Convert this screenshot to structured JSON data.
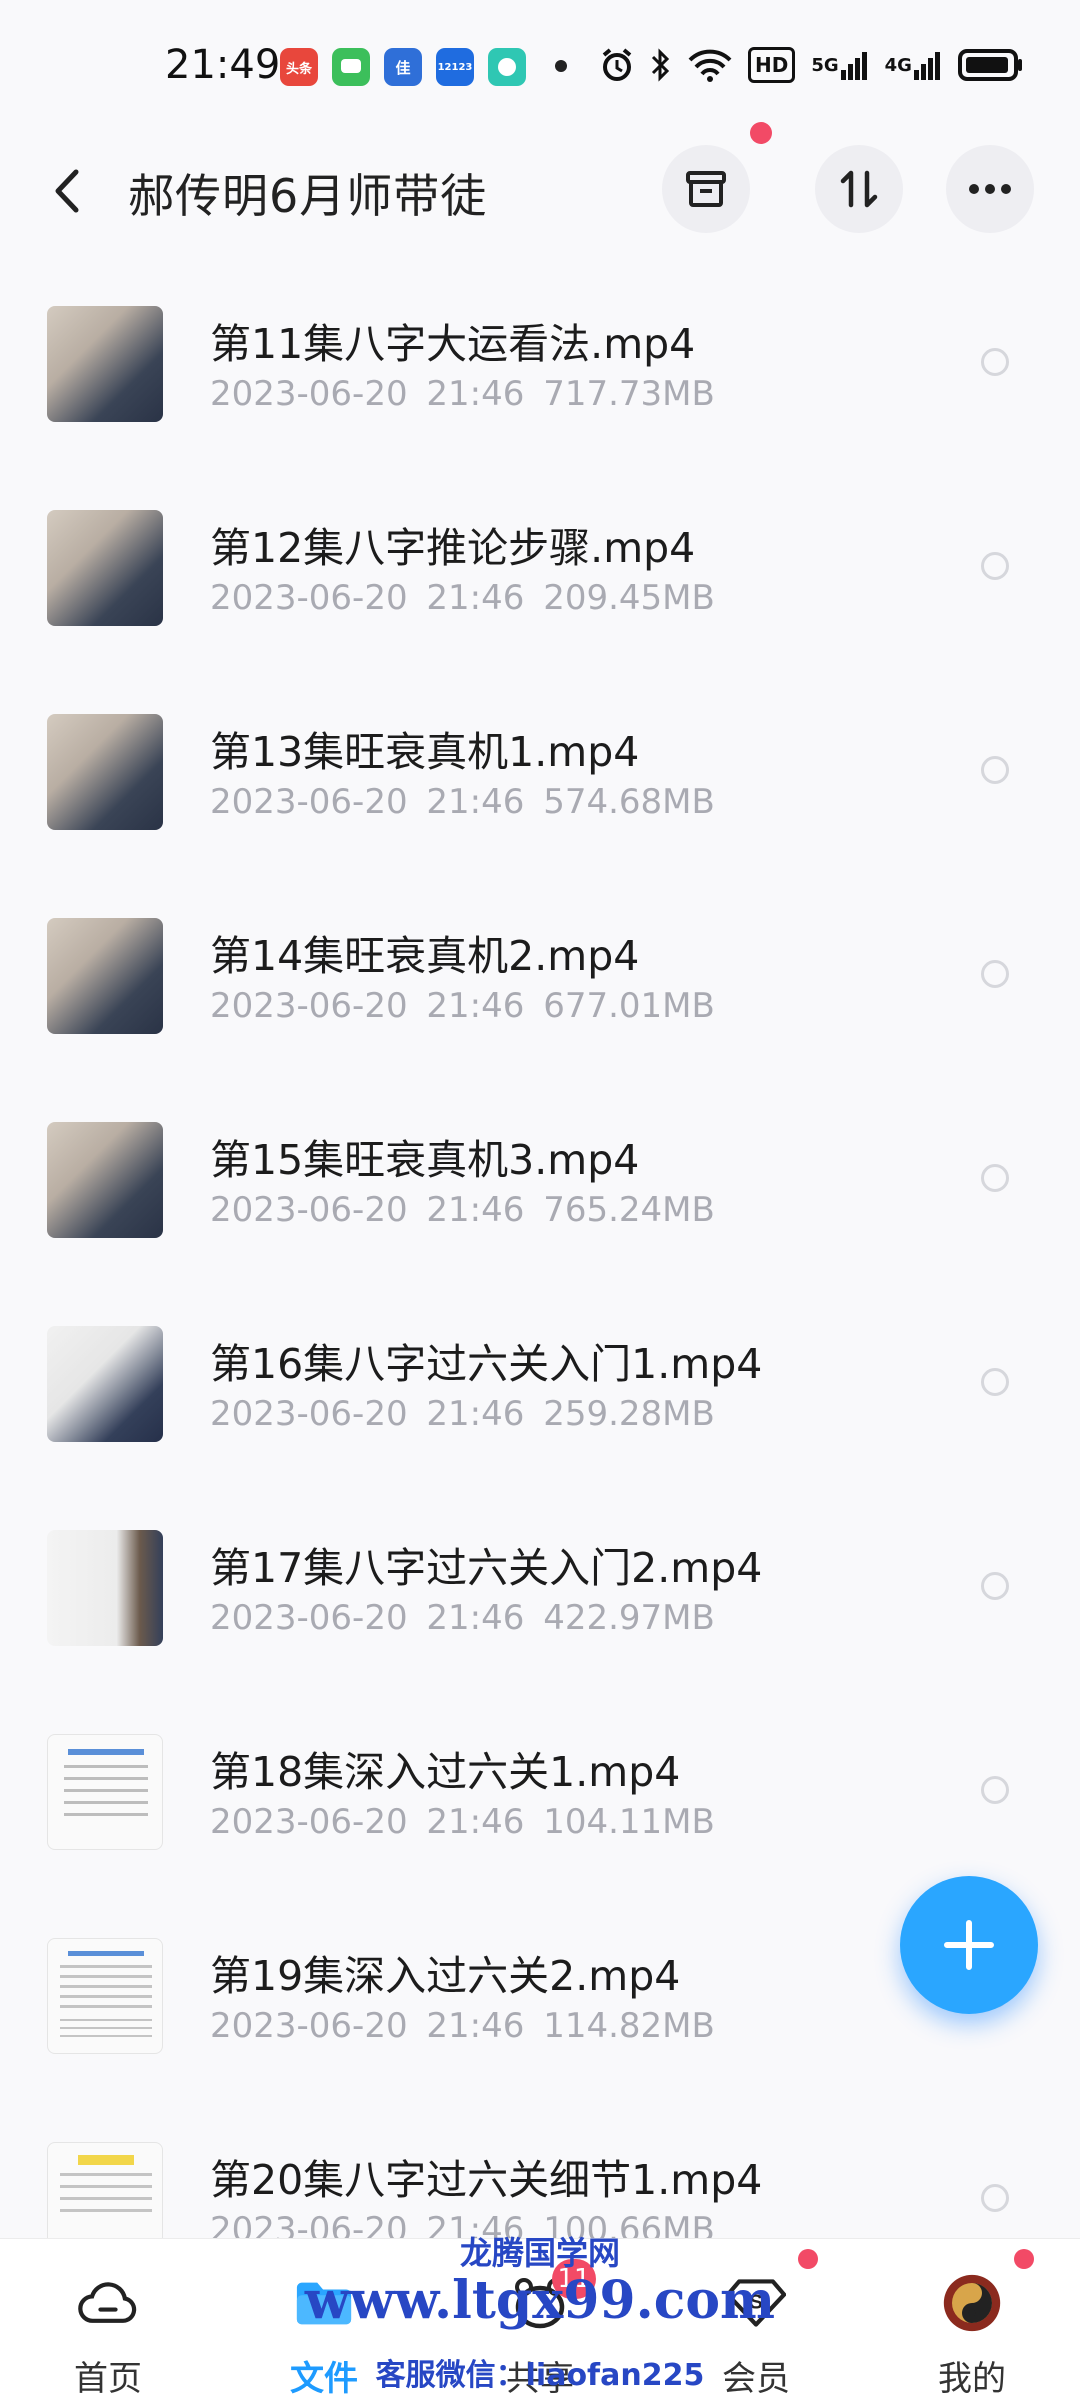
{
  "status_bar": {
    "time": "21:49",
    "apps": [
      {
        "name": "toutiao-app-icon",
        "label": "头条",
        "color": "#e8473c"
      },
      {
        "name": "wechat-app-icon",
        "label": "",
        "color": "#3cbf5b"
      },
      {
        "name": "jia-app-icon",
        "label": "佳",
        "color": "#2f6fd8"
      },
      {
        "name": "12123-app-icon",
        "label": "12123",
        "color": "#1f6ce0"
      },
      {
        "name": "chat-app-icon",
        "label": "",
        "color": "#2fc7b3"
      }
    ],
    "hd_label": "HD",
    "net1": "5G",
    "net2": "4G"
  },
  "header": {
    "title": "郝传明6月师带徒"
  },
  "files": [
    {
      "name": "第11集八字大运看法.mp4",
      "date": "2023-06-20",
      "time": "21:46",
      "size": "717.73MB",
      "thumb": "video"
    },
    {
      "name": "第12集八字推论步骤.mp4",
      "date": "2023-06-20",
      "time": "21:46",
      "size": "209.45MB",
      "thumb": "video"
    },
    {
      "name": "第13集旺衰真机1.mp4",
      "date": "2023-06-20",
      "time": "21:46",
      "size": "574.68MB",
      "thumb": "video"
    },
    {
      "name": "第14集旺衰真机2.mp4",
      "date": "2023-06-20",
      "time": "21:46",
      "size": "677.01MB",
      "thumb": "video"
    },
    {
      "name": "第15集旺衰真机3.mp4",
      "date": "2023-06-20",
      "time": "21:46",
      "size": "765.24MB",
      "thumb": "video"
    },
    {
      "name": "第16集八字过六关入门1.mp4",
      "date": "2023-06-20",
      "time": "21:46",
      "size": "259.28MB",
      "thumb": "video"
    },
    {
      "name": "第17集八字过六关入门2.mp4",
      "date": "2023-06-20",
      "time": "21:46",
      "size": "422.97MB",
      "thumb": "video"
    },
    {
      "name": "第18集深入过六关1.mp4",
      "date": "2023-06-20",
      "time": "21:46",
      "size": "104.11MB",
      "thumb": "doc"
    },
    {
      "name": "第19集深入过六关2.mp4",
      "date": "2023-06-20",
      "time": "21:46",
      "size": "114.82MB",
      "thumb": "doc"
    },
    {
      "name": "第20集八字过六关细节1.mp4",
      "date": "2023-06-20",
      "time": "21:46",
      "size": "100.66MB",
      "thumb": "doc"
    }
  ],
  "nav": [
    {
      "label": "首页",
      "icon": "cloud-home-icon"
    },
    {
      "label": "文件",
      "icon": "folder-icon"
    },
    {
      "label": "共享",
      "icon": "share-icon",
      "badge": "11"
    },
    {
      "label": "会员",
      "icon": "vip-diamond-icon"
    },
    {
      "label": "我的",
      "icon": "avatar-icon"
    }
  ],
  "watermark": {
    "line1": "龙腾国学网",
    "line2": "www.ltgx99.com",
    "line3": "客服微信：liaofan225"
  },
  "colors": {
    "accent": "#1e9bff",
    "badge": "#f24a66",
    "muted": "#a9aab2"
  }
}
